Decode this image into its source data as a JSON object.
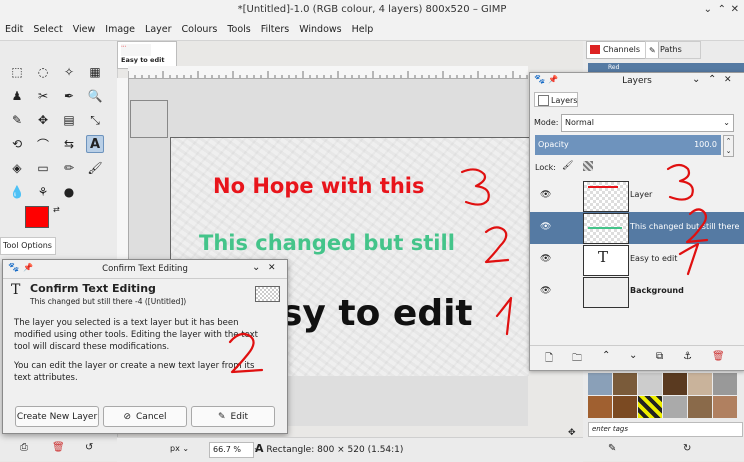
{
  "window": {
    "title": "*[Untitled]-1.0 (RGB colour, 4 layers) 800x520 – GIMP"
  },
  "menu": [
    "Edit",
    "Select",
    "View",
    "Image",
    "Layer",
    "Colours",
    "Tools",
    "Filters",
    "Windows",
    "Help"
  ],
  "image_tab": {
    "label": "Easy to edit"
  },
  "canvas": {
    "line1": "No Hope with this",
    "line2": "This changed but still",
    "line3": "sy to edit",
    "line1_color": "#e8141b",
    "line2_color": "#44c48a",
    "line3_color": "#111111"
  },
  "toolbox": {
    "fg_color": "#ff0000",
    "tool_options_tab": "Tool Options"
  },
  "dock_tabs": {
    "channels": "Channels",
    "paths": "Paths",
    "channel_red": "Red"
  },
  "layers_panel": {
    "title": "Layers",
    "tab": "Layers",
    "mode_label": "Mode:",
    "mode_value": "Normal",
    "opacity_label": "Opacity",
    "opacity_value": "100.0",
    "opacity": 1.0,
    "lock_label": "Lock:",
    "layers": [
      {
        "name": "Layer",
        "selected": false,
        "bold": false
      },
      {
        "name": "This changed but still there",
        "selected": true,
        "bold": false
      },
      {
        "name": "Easy to edit",
        "selected": false,
        "bold": false
      },
      {
        "name": "Background",
        "selected": false,
        "bold": true
      }
    ]
  },
  "dialog": {
    "title": "Confirm Text Editing",
    "heading": "Confirm Text Editing",
    "subheading": "This changed but still there -4 ([Untitled])",
    "body1": "The layer you selected is a text layer but it has been modified using other tools. Editing the layer with the text tool will discard these modifications.",
    "body2": "You can edit the layer or create a new text layer from its text attributes.",
    "btn_new": "Create New Layer",
    "btn_cancel": "Cancel",
    "btn_edit": "Edit"
  },
  "statusbar": {
    "unit": "px",
    "zoom": "66.7 %",
    "message": "Rectangle: 800 × 520  (1.54:1)"
  },
  "brushes": {
    "filter": "enter tags"
  },
  "annotations": [
    "3",
    "2",
    "1",
    "3",
    "2",
    "1",
    "2"
  ]
}
